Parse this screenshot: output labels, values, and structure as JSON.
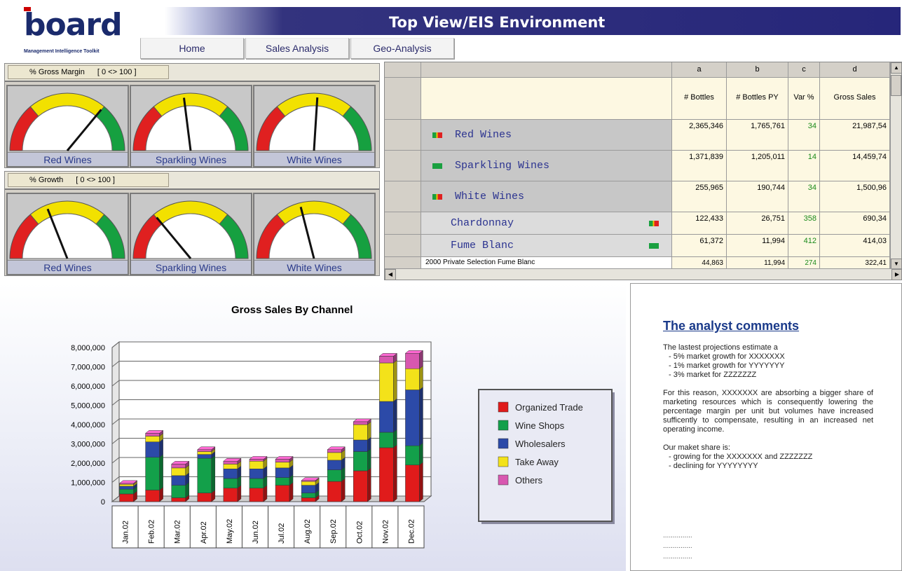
{
  "header": {
    "logo_text": "board",
    "logo_subtitle": "Management Intelligence Toolkit",
    "title": "Top View/EIS Environment",
    "tabs": [
      {
        "label": "Home"
      },
      {
        "label": "Sales Analysis"
      },
      {
        "label": "Geo-Analysis"
      }
    ]
  },
  "gauge_panels": [
    {
      "label": "% Gross Margin",
      "range": "[ 0 <> 100 ]",
      "gauges": [
        {
          "label": "Red Wines",
          "value": 72
        },
        {
          "label": "Sparkling Wines",
          "value": 46
        },
        {
          "label": "White Wines",
          "value": 52
        }
      ]
    },
    {
      "label": "% Growth",
      "range": "[ 0 <> 100 ]",
      "gauges": [
        {
          "label": "Red Wines",
          "value": 38
        },
        {
          "label": "Sparkling Wines",
          "value": 28
        },
        {
          "label": "White Wines",
          "value": 42
        }
      ]
    }
  ],
  "grid": {
    "column_letters": [
      "a",
      "b",
      "c",
      "d"
    ],
    "column_headers": [
      "# Bottles",
      "# Bottles PY",
      "Var %",
      "Gross Sales"
    ],
    "rows": [
      {
        "name": "Red Wines",
        "flag": "mix",
        "values": [
          "2,365,346",
          "1,765,761",
          "34",
          "21,987,54"
        ]
      },
      {
        "name": "Sparkling Wines",
        "flag": "green",
        "values": [
          "1,371,839",
          "1,205,011",
          "14",
          "14,459,74"
        ]
      },
      {
        "name": "White Wines",
        "flag": "mix",
        "values": [
          "255,965",
          "190,744",
          "34",
          "1,500,96"
        ]
      },
      {
        "name": "Chardonnay",
        "flag": "mix",
        "values": [
          "122,433",
          "26,751",
          "358",
          "690,34"
        ]
      },
      {
        "name": "Fume Blanc",
        "flag": "green",
        "values": [
          "61,372",
          "11,994",
          "412",
          "414,03"
        ]
      },
      {
        "name": "2000 Private Selection Fume Blanc",
        "flag": "",
        "values": [
          "44,863",
          "11,994",
          "274",
          "322,41"
        ]
      }
    ]
  },
  "chart_data": {
    "type": "bar",
    "stacked": true,
    "title": "Gross Sales By Channel",
    "categories": [
      "Jan.02",
      "Feb.02",
      "Mar.02",
      "Apr.02",
      "May.02",
      "Jun.02",
      "Jul.02",
      "Aug.02",
      "Sep.02",
      "Oct.02",
      "Nov.02",
      "Dec.02"
    ],
    "ylim": [
      0,
      8000000
    ],
    "yticks": [
      "0",
      "1,000,000",
      "2,000,000",
      "3,000,000",
      "4,000,000",
      "5,000,000",
      "6,000,000",
      "7,000,000",
      "8,000,000"
    ],
    "grid": true,
    "legend_position": "right",
    "series": [
      {
        "name": "Organized Trade",
        "color": "#e01b1b",
        "values": [
          400000,
          600000,
          200000,
          450000,
          700000,
          700000,
          850000,
          200000,
          1050000,
          1600000,
          2800000,
          1900000
        ]
      },
      {
        "name": "Wine Shops",
        "color": "#13a04a",
        "values": [
          250000,
          1700000,
          650000,
          1800000,
          500000,
          500000,
          400000,
          250000,
          600000,
          1000000,
          800000,
          1000000
        ]
      },
      {
        "name": "Wholesalers",
        "color": "#2c4aa8",
        "values": [
          150000,
          800000,
          500000,
          200000,
          500000,
          500000,
          500000,
          400000,
          500000,
          600000,
          1600000,
          2900000
        ]
      },
      {
        "name": "Take Away",
        "color": "#f3e21a",
        "values": [
          100000,
          300000,
          400000,
          150000,
          250000,
          400000,
          300000,
          200000,
          400000,
          800000,
          2000000,
          1100000
        ]
      },
      {
        "name": "Others",
        "color": "#d857b0",
        "values": [
          50000,
          150000,
          200000,
          100000,
          150000,
          100000,
          150000,
          50000,
          150000,
          150000,
          350000,
          800000
        ]
      }
    ]
  },
  "comments": {
    "title": "The analyst comments",
    "intro": "The lastest projections estimate a",
    "bullets1": [
      "- 5% market growth for XXXXXXX",
      "- 1% market growth for YYYYYYY",
      "- 3% market for ZZZZZZZ"
    ],
    "paragraph": "For this reason, XXXXXXX are absorbing a bigger share of marketing resources which is consequently lowering the percentage margin per unit but volumes have increased sufficently to compensate, resulting in an increased net operating income.",
    "share_intro": "Our maket share is:",
    "bullets2": [
      "- growing for the XXXXXXX and ZZZZZZZ",
      "- declining for YYYYYYYY"
    ],
    "dots": [
      "...............",
      "...............",
      "..............."
    ]
  },
  "colors": {
    "title_bar": "#26267a",
    "gauge_red": "#e02020",
    "gauge_yellow": "#f2e100",
    "gauge_green": "#16a040",
    "row_name_text": "#2b3390",
    "positive_var": "#1a8a1a",
    "comments_title": "#1a3a8a"
  }
}
